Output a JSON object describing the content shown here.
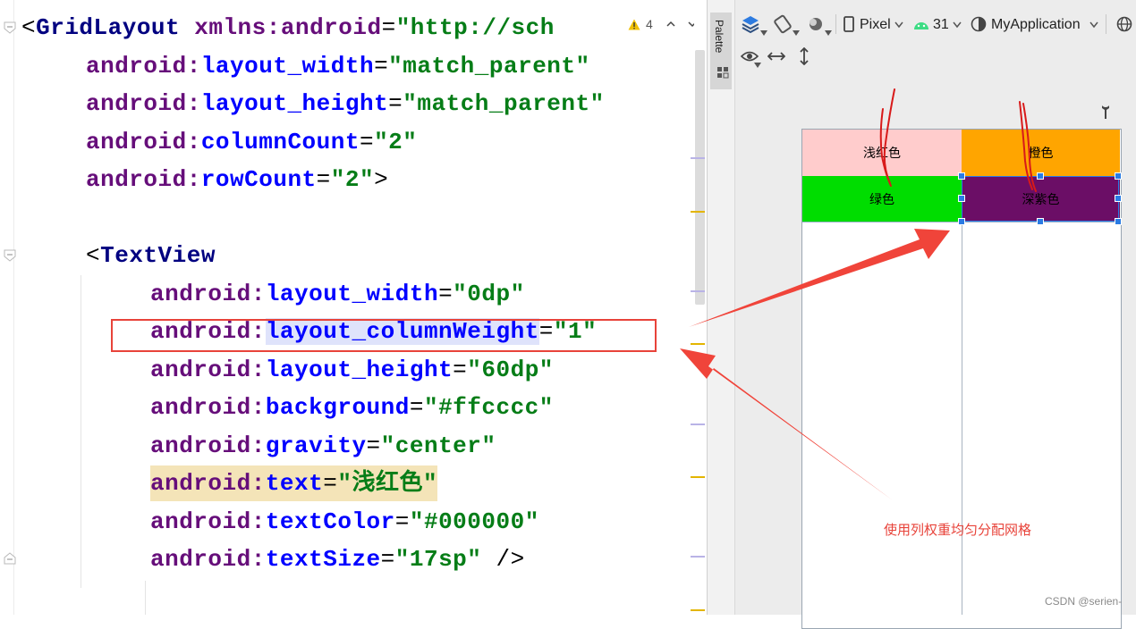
{
  "editor": {
    "lines": [
      {
        "indent": 0,
        "tokens": [
          {
            "t": "<",
            "c": "bracket"
          },
          {
            "t": "GridLayout",
            "c": "tag"
          },
          {
            "t": " ",
            "c": "eq"
          },
          {
            "t": "xmlns:",
            "c": "ns"
          },
          {
            "t": "android",
            "c": "ns"
          },
          {
            "t": "=",
            "c": "eq"
          },
          {
            "t": "\"http://sch",
            "c": "str"
          }
        ]
      },
      {
        "indent": 1,
        "tokens": [
          {
            "t": "android:",
            "c": "ns"
          },
          {
            "t": "layout_width",
            "c": "attr"
          },
          {
            "t": "=",
            "c": "eq"
          },
          {
            "t": "\"match_parent\"",
            "c": "str"
          }
        ]
      },
      {
        "indent": 1,
        "tokens": [
          {
            "t": "android:",
            "c": "ns"
          },
          {
            "t": "layout_height",
            "c": "attr"
          },
          {
            "t": "=",
            "c": "eq"
          },
          {
            "t": "\"match_parent\"",
            "c": "str"
          }
        ]
      },
      {
        "indent": 1,
        "tokens": [
          {
            "t": "android:",
            "c": "ns"
          },
          {
            "t": "columnCount",
            "c": "attr"
          },
          {
            "t": "=",
            "c": "eq"
          },
          {
            "t": "\"2\"",
            "c": "str"
          }
        ]
      },
      {
        "indent": 1,
        "tokens": [
          {
            "t": "android:",
            "c": "ns"
          },
          {
            "t": "rowCount",
            "c": "attr"
          },
          {
            "t": "=",
            "c": "eq"
          },
          {
            "t": "\"2\"",
            "c": "str"
          },
          {
            "t": ">",
            "c": "bracket"
          }
        ]
      },
      {
        "indent": 0,
        "tokens": []
      },
      {
        "indent": 1,
        "tokens": [
          {
            "t": "<",
            "c": "bracket"
          },
          {
            "t": "TextView",
            "c": "tag"
          }
        ]
      },
      {
        "indent": 2,
        "tokens": [
          {
            "t": "android:",
            "c": "ns"
          },
          {
            "t": "layout_width",
            "c": "attr"
          },
          {
            "t": "=",
            "c": "eq"
          },
          {
            "t": "\"0dp\"",
            "c": "str"
          }
        ]
      },
      {
        "indent": 2,
        "tokens": [
          {
            "t": "android:",
            "c": "ns"
          },
          {
            "t": "layout_columnWeight",
            "c": "attr",
            "hl": true
          },
          {
            "t": "=",
            "c": "eq"
          },
          {
            "t": "\"1\"",
            "c": "str"
          }
        ]
      },
      {
        "indent": 2,
        "tokens": [
          {
            "t": "android:",
            "c": "ns"
          },
          {
            "t": "layout_height",
            "c": "attr"
          },
          {
            "t": "=",
            "c": "eq"
          },
          {
            "t": "\"60dp\"",
            "c": "str"
          }
        ]
      },
      {
        "indent": 2,
        "tokens": [
          {
            "t": "android:",
            "c": "ns"
          },
          {
            "t": "background",
            "c": "attr"
          },
          {
            "t": "=",
            "c": "eq"
          },
          {
            "t": "\"#ffcccc\"",
            "c": "str"
          }
        ]
      },
      {
        "indent": 2,
        "tokens": [
          {
            "t": "android:",
            "c": "ns"
          },
          {
            "t": "gravity",
            "c": "attr"
          },
          {
            "t": "=",
            "c": "eq"
          },
          {
            "t": "\"center\"",
            "c": "str"
          }
        ]
      },
      {
        "indent": 2,
        "lineHighlight": true,
        "tokens": [
          {
            "t": "android:",
            "c": "ns"
          },
          {
            "t": "text",
            "c": "attr"
          },
          {
            "t": "=",
            "c": "eq"
          },
          {
            "t": "\"浅红色\"",
            "c": "str"
          }
        ]
      },
      {
        "indent": 2,
        "tokens": [
          {
            "t": "android:",
            "c": "ns"
          },
          {
            "t": "textColor",
            "c": "attr"
          },
          {
            "t": "=",
            "c": "eq"
          },
          {
            "t": "\"#000000\"",
            "c": "str"
          }
        ]
      },
      {
        "indent": 2,
        "tokens": [
          {
            "t": "android:",
            "c": "ns"
          },
          {
            "t": "textSize",
            "c": "attr"
          },
          {
            "t": "=",
            "c": "eq"
          },
          {
            "t": "\"17sp\"",
            "c": "str"
          },
          {
            "t": " />",
            "c": "bracket"
          }
        ]
      }
    ],
    "inspection_count": "4"
  },
  "palette": {
    "label": "Palette"
  },
  "toolbar": {
    "device": "Pixel",
    "api_level": "31",
    "app_theme": "MyApplication"
  },
  "preview": {
    "cells": [
      {
        "text": "浅红色",
        "color": "#ffcccc"
      },
      {
        "text": "橙色",
        "color": "#ffa500"
      },
      {
        "text": "绿色",
        "color": "#00dd00"
      },
      {
        "text": "深紫色",
        "color": "#6b0e66"
      }
    ]
  },
  "annotation": {
    "text": "使用列权重均匀分配网格"
  },
  "watermark": "CSDN @serien-",
  "colors": {
    "annotation_red": "#e8433a",
    "selection_blue": "#2a7be4"
  }
}
